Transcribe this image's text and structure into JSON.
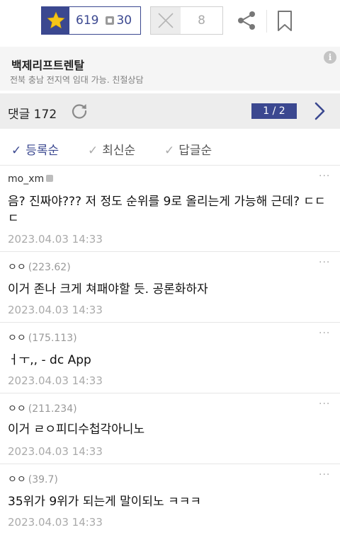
{
  "action_bar": {
    "recommend_count": "619",
    "fixed_recommend_count": "30",
    "nonrecommend_count": "8",
    "colors": {
      "accent": "#3b4890",
      "star": "#f5c518"
    },
    "icons": [
      "star-icon",
      "x-icon",
      "share-icon",
      "bookmark-icon"
    ]
  },
  "ad": {
    "title": "백제리프트렌탈",
    "subtitle": "전북 충남 전지역 임대 가능. 친절상담",
    "info_icon": "i"
  },
  "comment_header": {
    "label": "댓글 172",
    "page": "1 / 2"
  },
  "sort": {
    "tabs": [
      {
        "label": "등록순",
        "active": true
      },
      {
        "label": "최신순",
        "active": false
      },
      {
        "label": "답글순",
        "active": false
      }
    ],
    "check": "✓"
  },
  "comments": [
    {
      "author": "mo_xm",
      "ip": "",
      "text": "음? 진짜야??? 저 정도 순위를 9로 올리는게 가능해 근데? ㄷㄷㄷ",
      "date": "2023.04.03 14:33"
    },
    {
      "author": "ㅇㅇ",
      "ip": "(223.62)",
      "text": "이거 존나 크게 쳐패야할 듯. 공론화하자",
      "date": "2023.04.03 14:33"
    },
    {
      "author": "ㅇㅇ",
      "ip": "(175.113)",
      "text": "ㅓㅜ,, - dc App",
      "date": "2023.04.03 14:33"
    },
    {
      "author": "ㅇㅇ",
      "ip": "(211.234)",
      "text": "이거 ㄹㅇ피디수첩각아니노",
      "date": "2023.04.03 14:33"
    },
    {
      "author": "ㅇㅇ",
      "ip": "(39.7)",
      "text": "35위가 9위가 되는게 말이되노 ㅋㅋㅋ",
      "date": "2023.04.03 14:33"
    }
  ],
  "more_glyph": "···"
}
